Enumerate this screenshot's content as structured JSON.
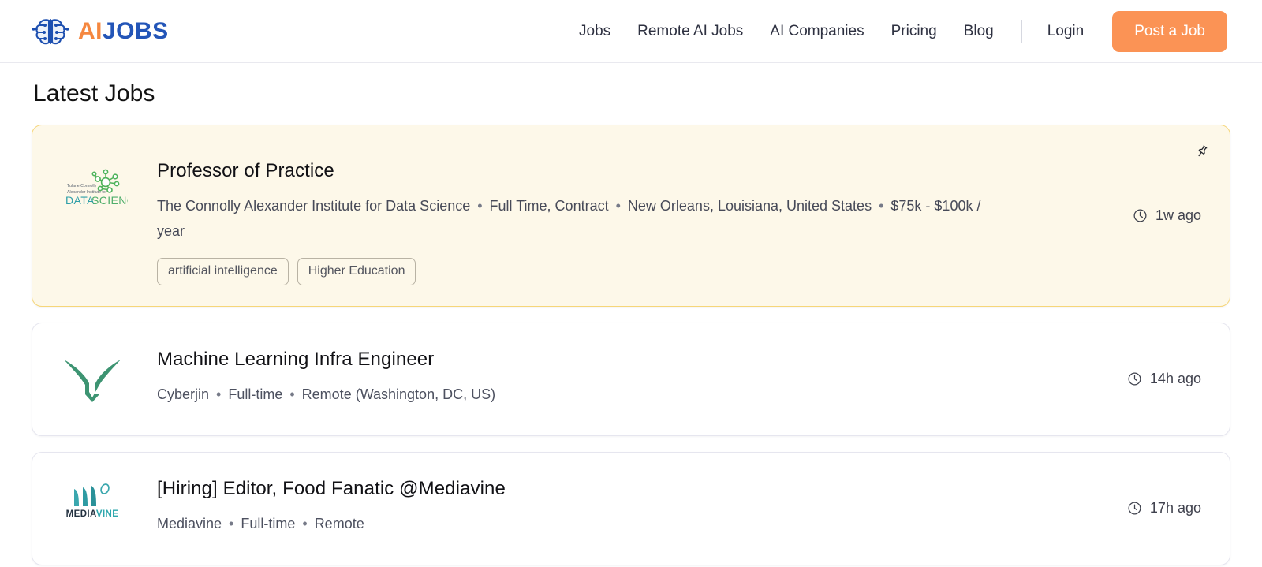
{
  "header": {
    "logo": {
      "icon": "brain-circuit-icon",
      "text_a": "AI",
      "text_b": "JOBS"
    },
    "nav_links": [
      {
        "label": "Jobs",
        "name": "nav-link-jobs"
      },
      {
        "label": "Remote AI Jobs",
        "name": "nav-link-remote-ai-jobs"
      },
      {
        "label": "AI Companies",
        "name": "nav-link-ai-companies"
      },
      {
        "label": "Pricing",
        "name": "nav-link-pricing"
      },
      {
        "label": "Blog",
        "name": "nav-link-blog"
      }
    ],
    "login_label": "Login",
    "post_job_label": "Post a Job",
    "accent_color": "#fb9355",
    "brand_blue": "#2355b8",
    "brand_orange": "#f5873f"
  },
  "main": {
    "page_title": "Latest Jobs",
    "jobs": [
      {
        "title": "Professor of Practice",
        "company": "The Connolly Alexander Institute for Data Science",
        "employment_type": "Full Time, Contract",
        "location": "New Orleans, Louisiana, United States",
        "salary": "$75k - $100k / year",
        "tags": [
          "artificial intelligence",
          "Higher Education"
        ],
        "posted": "1w ago",
        "featured": true,
        "pinned": true,
        "logo_name": "connolly-alexander-data-science-logo",
        "logo_alt": "DATA SCIENCE"
      },
      {
        "title": "Machine Learning Infra Engineer",
        "company": "Cyberjin",
        "employment_type": "Full-time",
        "location": "Remote (Washington, DC, US)",
        "salary": "",
        "tags": [],
        "posted": "14h ago",
        "featured": false,
        "pinned": false,
        "logo_name": "cyberjin-logo",
        "logo_alt": "Cyberjin"
      },
      {
        "title": "[Hiring] Editor, Food Fanatic @Mediavine",
        "company": "Mediavine",
        "employment_type": "Full-time",
        "location": "Remote",
        "salary": "",
        "tags": [],
        "posted": "17h ago",
        "featured": false,
        "pinned": false,
        "logo_name": "mediavine-logo",
        "logo_alt_a": "MEDIA",
        "logo_alt_b": "VINE"
      }
    ],
    "separator": "•",
    "featured_bg": "#fdf8e9",
    "featured_border": "#f6d679"
  }
}
